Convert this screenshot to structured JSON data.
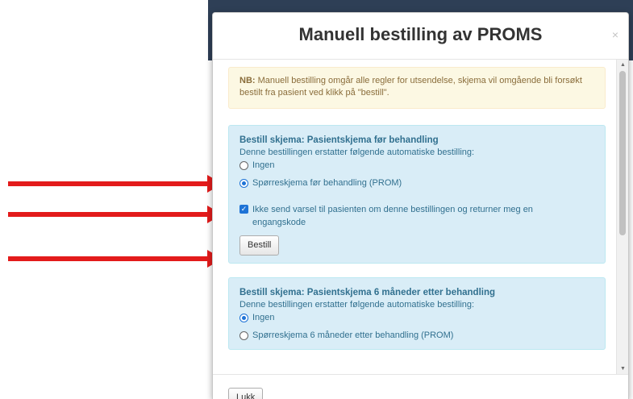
{
  "modal": {
    "title": "Manuell bestilling av PROMS",
    "close_label": "×",
    "notice_strong": "NB:",
    "notice_text": " Manuell bestilling omgår alle regler for utsendelse, skjema vil omgående bli forsøkt bestilt fra pasient ved klikk på \"bestill\".",
    "footer_close_label": "Lukk"
  },
  "panels": [
    {
      "title": "Bestill skjema: Pasientskjema før behandling",
      "description": "Denne bestillingen erstatter følgende automatiske bestilling:",
      "options": [
        {
          "label": "Ingen",
          "checked": false
        },
        {
          "label": "Spørreskjema før behandling (PROM)",
          "checked": true
        }
      ],
      "checkbox_label": "Ikke send varsel til pasienten om denne bestillingen og returner meg en engangskode",
      "checkbox_checked": true,
      "order_button_label": "Bestill"
    },
    {
      "title": "Bestill skjema: Pasientskjema 6 måneder etter behandling",
      "description": "Denne bestillingen erstatter følgende automatiske bestilling:",
      "options": [
        {
          "label": "Ingen",
          "checked": true
        },
        {
          "label": "Spørreskjema 6 måneder etter behandling (PROM)",
          "checked": false
        }
      ]
    }
  ],
  "icons": {
    "scroll_up": "triangle-up-icon",
    "scroll_down": "triangle-down-icon",
    "checkbox_mark": "✓",
    "arrow_color": "#e31b1b"
  },
  "colors": {
    "accent": "#1e73d6",
    "info_bg": "#d9edf7",
    "info_text": "#31708f",
    "warning_bg": "#fcf8e3",
    "warning_text": "#8a6d3b"
  }
}
